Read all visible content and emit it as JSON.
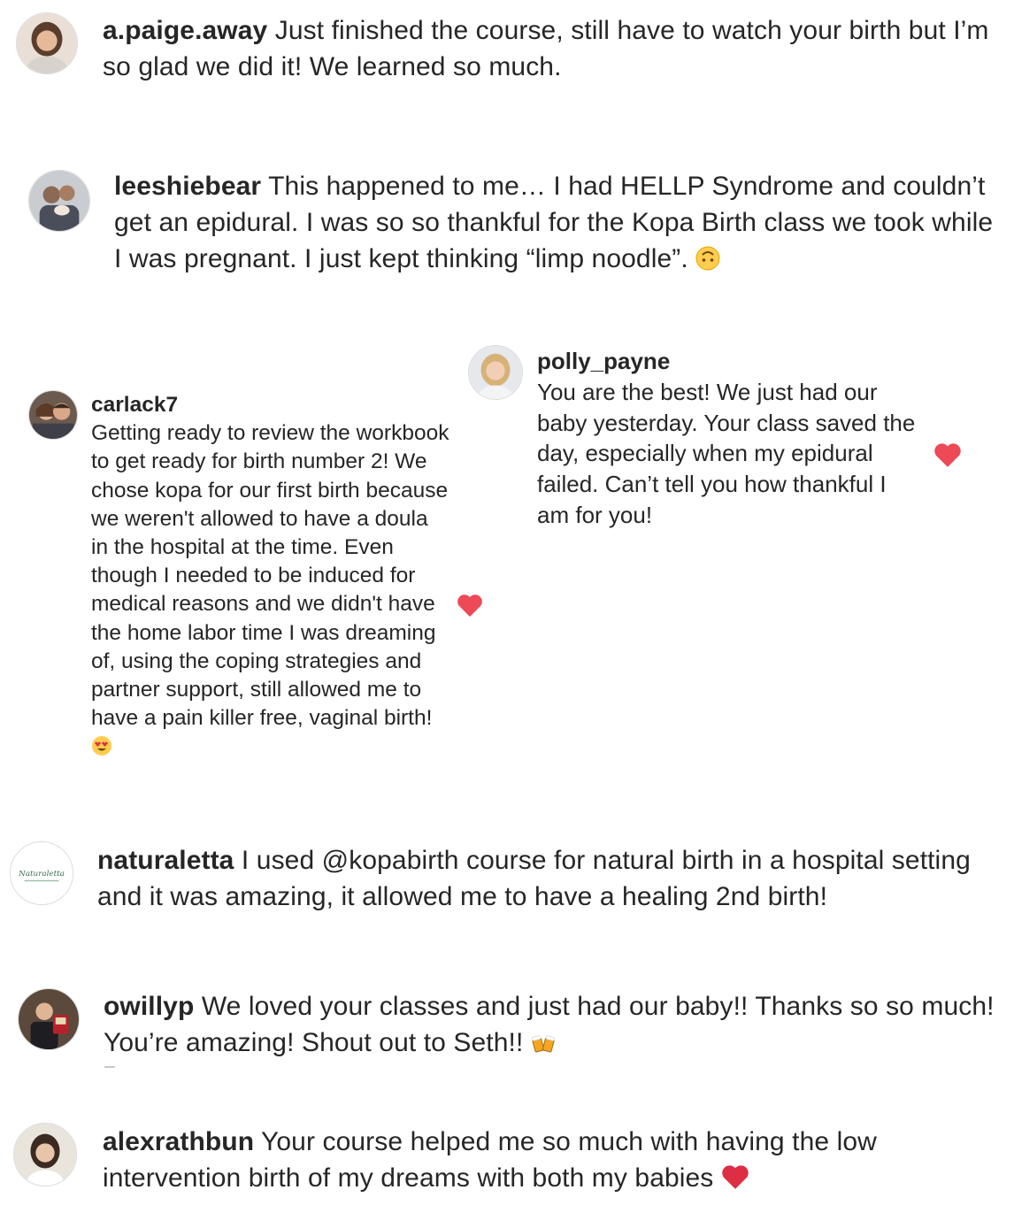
{
  "comments": [
    {
      "username": "a.paige.away",
      "text": "Just finished the course, still have to watch your birth but I’m so glad we did it! We learned so much."
    },
    {
      "username": "leeshiebear",
      "text": "This happened to me… I had HELLP Syndrome and couldn’t get an epidural. I was so so thankful for the Kopa Birth class we took while I was pregnant. I just kept thinking “limp noodle”.",
      "emoji": "upside-down-face"
    },
    {
      "username": "carlack7",
      "text": "Getting ready to review the workbook to get ready for birth number 2! We chose kopa for our first birth because we weren't allowed to have a doula in the hospital at the time. Even though I needed to be induced for medical reasons and we didn't have the home labor time I was dreaming of, using the coping strategies and partner support, still allowed me to have a pain killer free, vaginal birth!",
      "emoji": "heart-eyes",
      "liked": true
    },
    {
      "username": "polly_payne",
      "text": "You are the best! We just had our baby yesterday. Your class saved the day, especially when my epidural failed. Can’t tell you how thankful I am for you!",
      "liked": true
    },
    {
      "username": "naturaletta",
      "avatar_text": "Naturaletta",
      "text": "I used @kopabirth course for natural birth in a hospital setting and it was amazing, it allowed me to have a healing 2nd birth!"
    },
    {
      "username": "owillyp",
      "text": "We loved your classes and just had our baby!! Thanks so so much! You’re amazing! Shout out to Seth!!",
      "emoji": "clinking-beer-mugs"
    },
    {
      "username": "alexrathbun",
      "text": "Your course helped me so much with having the low intervention birth of my dreams with both my babies",
      "emoji": "red-heart"
    }
  ],
  "colors": {
    "text": "#262626",
    "like_heart": "#ed4956",
    "border": "#dbdbdb"
  }
}
